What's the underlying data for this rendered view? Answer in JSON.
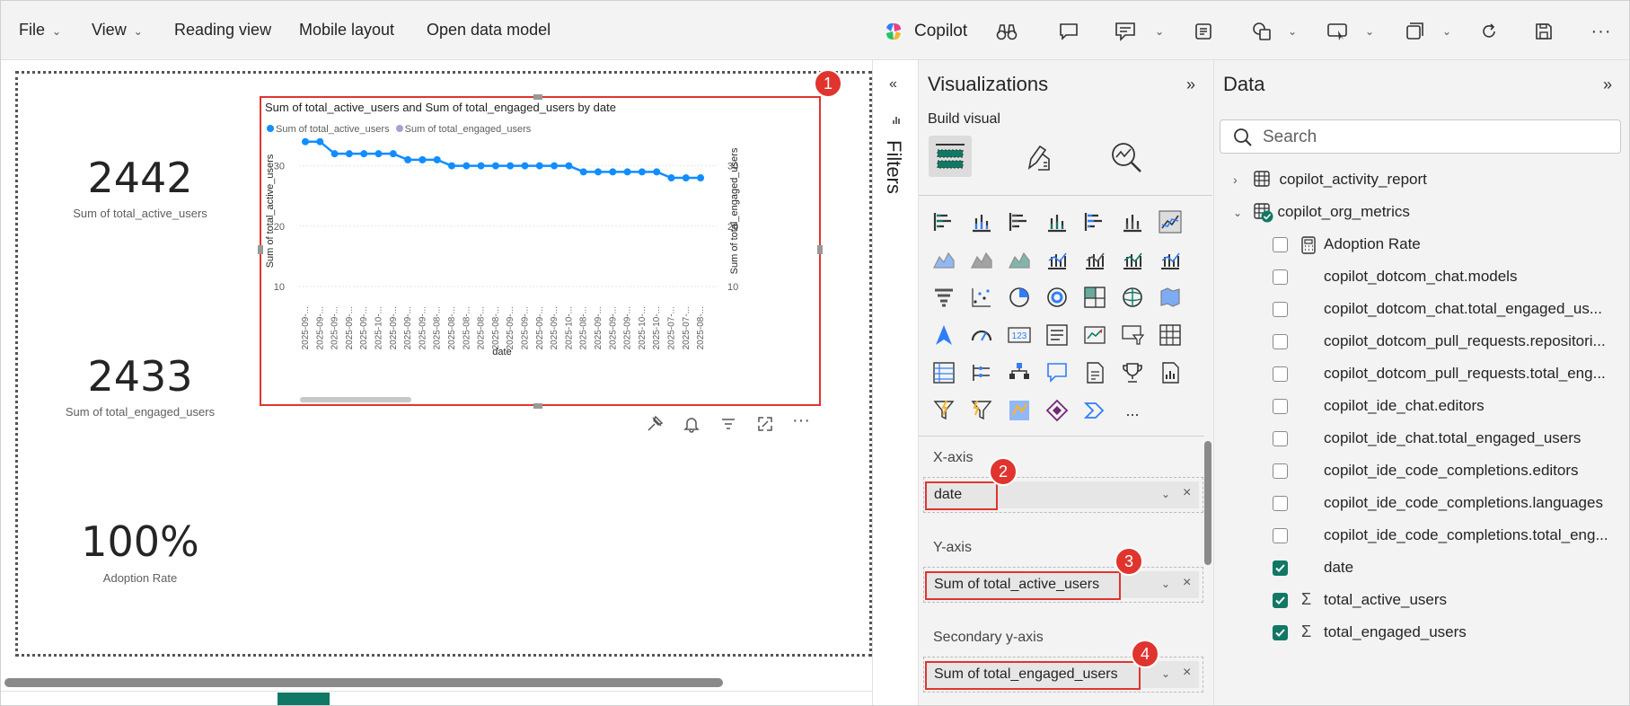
{
  "menu": {
    "file": "File",
    "view": "View",
    "reading_view": "Reading view",
    "mobile_layout": "Mobile layout",
    "open_data_model": "Open data model",
    "copilot": "Copilot"
  },
  "kpis": [
    {
      "value": "2442",
      "label": "Sum of total_active_users"
    },
    {
      "value": "2433",
      "label": "Sum of total_engaged_users"
    },
    {
      "value": "100%",
      "label": "Adoption Rate"
    }
  ],
  "chart_data": {
    "type": "line",
    "title": "Sum of total_active_users and Sum of total_engaged_users by date",
    "xlabel": "date",
    "ylabel": "Sum of total_active_users",
    "y2label": "Sum of total_engaged_users",
    "ylim": [
      10,
      35
    ],
    "yticks": [
      "30",
      "20",
      "10"
    ],
    "y2ticks": [
      "30",
      "20",
      "10"
    ],
    "x": [
      "2025-09-...",
      "2025-09-...",
      "2025-09-...",
      "2025-09-...",
      "2025-09-...",
      "2025-10-...",
      "2025-09-...",
      "2025-09-...",
      "2025-09-...",
      "2025-08-...",
      "2025-08-...",
      "2025-08-...",
      "2025-08-...",
      "2025-08-...",
      "2025-09-...",
      "2025-09-...",
      "2025-09-...",
      "2025-09-...",
      "2025-10-...",
      "2025-08-...",
      "2025-09-...",
      "2025-09-...",
      "2025-09-...",
      "2025-10-...",
      "2025-10-...",
      "2025-07-...",
      "2025-07-...",
      "2025-08-..."
    ],
    "series": [
      {
        "name": "Sum of total_active_users",
        "color": "#118dff",
        "values": [
          34,
          34,
          32,
          32,
          32,
          32,
          32,
          31,
          31,
          31,
          30,
          30,
          30,
          30,
          30,
          30,
          30,
          30,
          30,
          29,
          29,
          29,
          29,
          29,
          29,
          28,
          28,
          28
        ]
      },
      {
        "name": "Sum of total_engaged_users",
        "color": "#a0a3d6"
      }
    ],
    "grid": true,
    "legend": "top-left"
  },
  "filters": {
    "label": "Filters"
  },
  "visualizations": {
    "title": "Visualizations",
    "build_visual": "Build visual",
    "x_axis_label": "X-axis",
    "x_axis_value": "date",
    "y_axis_label": "Y-axis",
    "y_axis_value": "Sum of total_active_users",
    "secondary_label": "Secondary y-axis",
    "secondary_value": "Sum of total_engaged_users",
    "more": "..."
  },
  "badges": [
    "1",
    "2",
    "3",
    "4"
  ],
  "data_pane": {
    "title": "Data",
    "search_placeholder": "Search",
    "tables": [
      {
        "name": "copilot_activity_report",
        "expanded": false
      },
      {
        "name": "copilot_org_metrics",
        "expanded": true
      }
    ],
    "fields": [
      {
        "name": "Adoption Rate",
        "checked": false,
        "type": "measure"
      },
      {
        "name": "copilot_dotcom_chat.models",
        "checked": false,
        "type": "field"
      },
      {
        "name": "copilot_dotcom_chat.total_engaged_us...",
        "checked": false,
        "type": "field"
      },
      {
        "name": "copilot_dotcom_pull_requests.repositori...",
        "checked": false,
        "type": "field"
      },
      {
        "name": "copilot_dotcom_pull_requests.total_eng...",
        "checked": false,
        "type": "field"
      },
      {
        "name": "copilot_ide_chat.editors",
        "checked": false,
        "type": "field"
      },
      {
        "name": "copilot_ide_chat.total_engaged_users",
        "checked": false,
        "type": "field"
      },
      {
        "name": "copilot_ide_code_completions.editors",
        "checked": false,
        "type": "field"
      },
      {
        "name": "copilot_ide_code_completions.languages",
        "checked": false,
        "type": "field"
      },
      {
        "name": "copilot_ide_code_completions.total_eng...",
        "checked": false,
        "type": "field"
      },
      {
        "name": "date",
        "checked": true,
        "type": "field"
      },
      {
        "name": "total_active_users",
        "checked": true,
        "type": "sum"
      },
      {
        "name": "total_engaged_users",
        "checked": true,
        "type": "sum"
      }
    ]
  }
}
